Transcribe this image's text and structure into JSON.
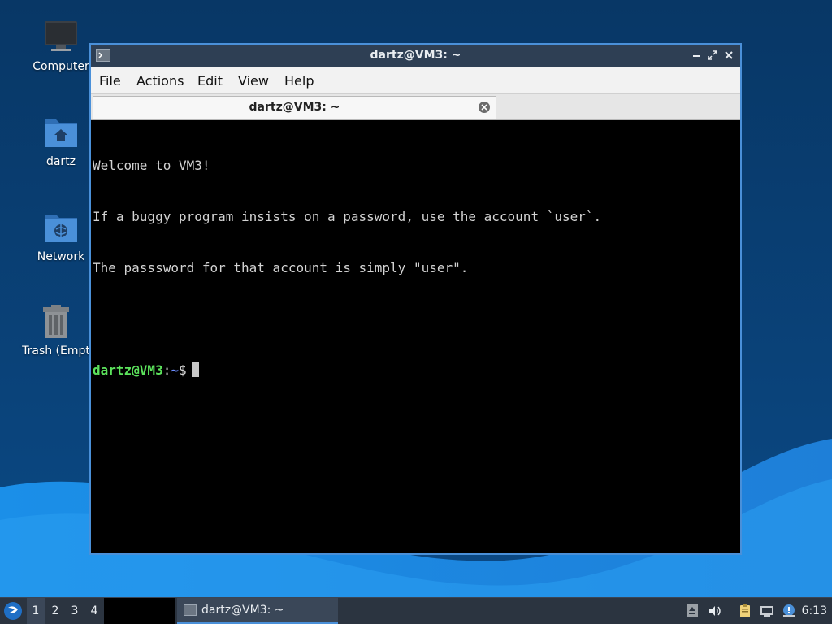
{
  "desktop": {
    "icons": [
      {
        "label": "Computer"
      },
      {
        "label": "dartz"
      },
      {
        "label": "Network"
      },
      {
        "label": "Trash (Empt"
      }
    ]
  },
  "window": {
    "title": "dartz@VM3: ~",
    "menu": [
      "File",
      "Actions",
      "Edit",
      "View",
      "Help"
    ],
    "tab": {
      "label": "dartz@VM3: ~"
    }
  },
  "terminal": {
    "lines": [
      "Welcome to VM3!",
      "If a buggy program insists on a password, use the account `user`.",
      "The passsword for that account is simply \"user\".",
      ""
    ],
    "prompt": {
      "user_host": "dartz@VM3",
      "colon": ":",
      "path": "~",
      "symbol": "$"
    }
  },
  "taskbar": {
    "workspaces": [
      "1",
      "2",
      "3",
      "4"
    ],
    "active_workspace": "1",
    "task": {
      "label": "dartz@VM3: ~"
    },
    "clock": "6:13"
  },
  "colors": {
    "prompt_user": "#5ce35c",
    "prompt_path": "#6b8cff",
    "window_border": "#4a90d9"
  }
}
